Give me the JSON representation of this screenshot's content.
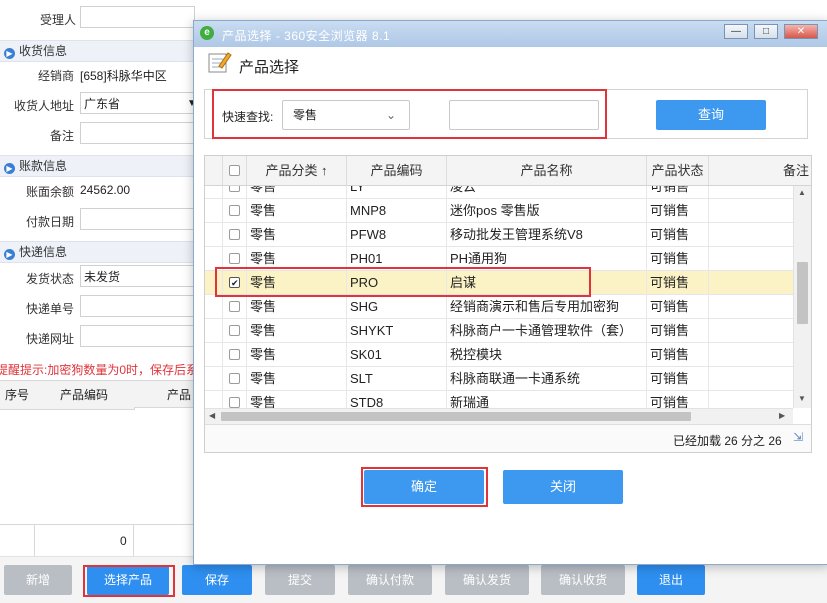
{
  "background": {
    "receiver_label": "受理人",
    "section_shipping": "收货信息",
    "dealer_label": "经销商",
    "dealer_value": "[658]科脉华中区",
    "address_label": "收货人地址",
    "address_value": "广东省",
    "remark_label": "备注",
    "section_account": "账款信息",
    "balance_label": "账面余额",
    "balance_value": "24562.00",
    "pay_date_label": "付款日期",
    "section_express": "快递信息",
    "ship_status_label": "发货状态",
    "ship_status_value": "未发货",
    "tracking_label": "快递单号",
    "express_url_label": "快递网址",
    "warning_text": "提醒提示:加密狗数量为0时，保存后系",
    "grid_col_seq": "序号",
    "grid_col_code": "产品编码",
    "grid_col_cut": "产品",
    "grid_sum_value": "0",
    "buttons": {
      "new": "新增",
      "select_product": "选择产品",
      "save": "保存",
      "submit": "提交",
      "confirm_payment": "确认付款",
      "confirm_shipment": "确认发货",
      "confirm_receipt": "确认收货",
      "exit": "退出"
    }
  },
  "popup": {
    "window_title": "产品选择 - 360安全浏览器 8.1",
    "header_title": "产品选择",
    "search_label": "快速查找:",
    "search_select_value": "零售",
    "search_text_value": "",
    "search_button": "查询",
    "columns": [
      "产品分类 ↑",
      "产品编码",
      "产品名称",
      "产品状态",
      "备注"
    ],
    "rows": [
      {
        "category": "零售",
        "code": "LY",
        "name": "凌云",
        "status": "可销售",
        "checked": false,
        "selected": false
      },
      {
        "category": "零售",
        "code": "MNP8",
        "name": "迷你pos 零售版",
        "status": "可销售",
        "checked": false,
        "selected": false
      },
      {
        "category": "零售",
        "code": "PFW8",
        "name": "移动批发王管理系统V8",
        "status": "可销售",
        "checked": false,
        "selected": false
      },
      {
        "category": "零售",
        "code": "PH01",
        "name": "PH通用狗",
        "status": "可销售",
        "checked": false,
        "selected": false
      },
      {
        "category": "零售",
        "code": "PRO",
        "name": "启谋",
        "status": "可销售",
        "checked": true,
        "selected": true
      },
      {
        "category": "零售",
        "code": "SHG",
        "name": "经销商演示和售后专用加密狗",
        "status": "可销售",
        "checked": false,
        "selected": false
      },
      {
        "category": "零售",
        "code": "SHYKT",
        "name": "科脉商户一卡通管理软件（套）",
        "status": "可销售",
        "checked": false,
        "selected": false
      },
      {
        "category": "零售",
        "code": "SK01",
        "name": "税控模块",
        "status": "可销售",
        "checked": false,
        "selected": false
      },
      {
        "category": "零售",
        "code": "SLT",
        "name": "科脉商联通一卡通系统",
        "status": "可销售",
        "checked": false,
        "selected": false
      },
      {
        "category": "零售",
        "code": "STD8",
        "name": "新瑞通",
        "status": "可销售",
        "checked": false,
        "selected": false
      }
    ],
    "loaded_text": "已经加载 26 分之 26",
    "confirm_button": "确定",
    "close_button": "关闭"
  },
  "colors": {
    "accent": "#3d98f0",
    "highlight_border": "#e0343a",
    "selected_row": "#fbf3c6"
  }
}
